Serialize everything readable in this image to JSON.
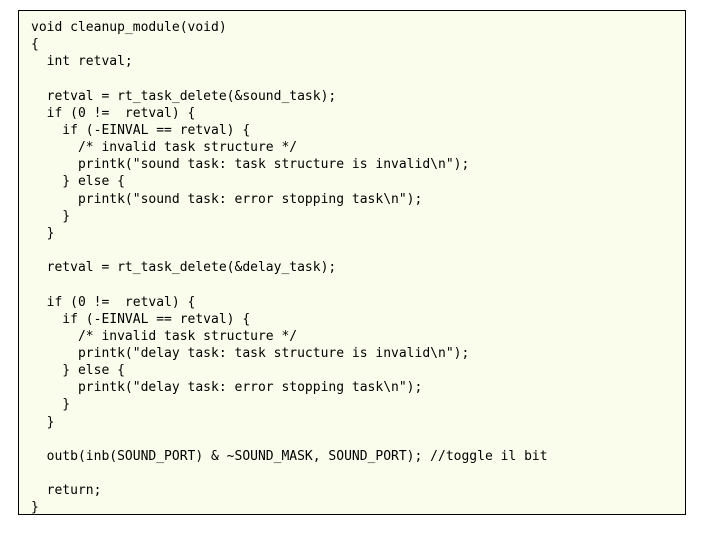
{
  "code": "void cleanup_module(void)\n{\n  int retval;\n\n  retval = rt_task_delete(&sound_task);\n  if (0 !=  retval) {\n    if (-EINVAL == retval) {\n      /* invalid task structure */\n      printk(\"sound task: task structure is invalid\\n\");\n    } else {\n      printk(\"sound task: error stopping task\\n\");\n    }\n  }\n\n  retval = rt_task_delete(&delay_task);\n\n  if (0 !=  retval) {\n    if (-EINVAL == retval) {\n      /* invalid task structure */\n      printk(\"delay task: task structure is invalid\\n\");\n    } else {\n      printk(\"delay task: error stopping task\\n\");\n    }\n  }\n\n  outb(inb(SOUND_PORT) & ~SOUND_MASK, SOUND_PORT); //toggle il bit\n\n  return;\n}"
}
